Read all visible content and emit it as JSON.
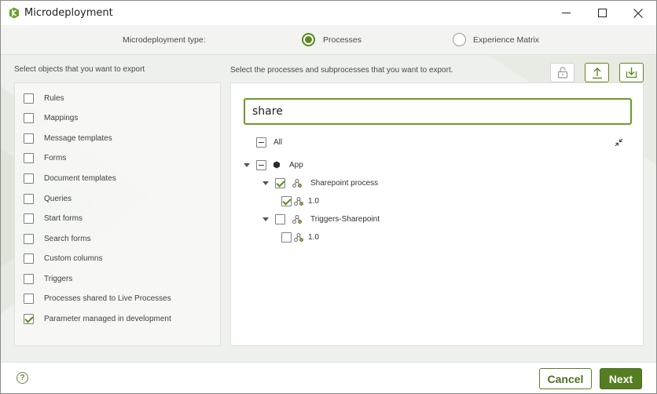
{
  "window": {
    "title": "Microdeployment",
    "controls": [
      "minimize-icon",
      "maximize-icon",
      "close-icon"
    ]
  },
  "type_selector": {
    "label": "Microdeployment type:",
    "options": [
      {
        "label": "Processes",
        "selected": true
      },
      {
        "label": "Experience Matrix",
        "selected": false
      }
    ]
  },
  "left": {
    "heading": "Select objects that you want to export",
    "items": [
      {
        "label": "Rules",
        "checked": false
      },
      {
        "label": "Mappings",
        "checked": false
      },
      {
        "label": "Message templates",
        "checked": false
      },
      {
        "label": "Forms",
        "checked": false
      },
      {
        "label": "Document templates",
        "checked": false
      },
      {
        "label": "Queries",
        "checked": false
      },
      {
        "label": "Start forms",
        "checked": false
      },
      {
        "label": "Search forms",
        "checked": false
      },
      {
        "label": "Custom columns",
        "checked": false
      },
      {
        "label": "Triggers",
        "checked": false
      },
      {
        "label": "Processes shared to Live Processes",
        "checked": false
      },
      {
        "label": "Parameter managed in development",
        "checked": true
      }
    ]
  },
  "right": {
    "heading": "Select the processes and subprocesses that you want to export.",
    "toolbar": [
      "unlock-icon",
      "upload-icon",
      "download-icon"
    ],
    "search": {
      "value": "share"
    },
    "tree": {
      "all_label": "All",
      "app_label": "App",
      "processes": [
        {
          "label": "Sharepoint process",
          "checked": true,
          "versions": [
            {
              "label": "1.0",
              "checked": true
            }
          ]
        },
        {
          "label": "Triggers-Sharepoint",
          "checked": false,
          "versions": [
            {
              "label": "1.0",
              "checked": false
            }
          ]
        }
      ]
    }
  },
  "footer": {
    "help_icon": "help-icon",
    "help_glyph": "?",
    "cancel_label": "Cancel",
    "next_label": "Next"
  },
  "colors": {
    "accent": "#5b8a1f",
    "primary_button": "#557d21",
    "panel_bg": "#eef0ec"
  }
}
